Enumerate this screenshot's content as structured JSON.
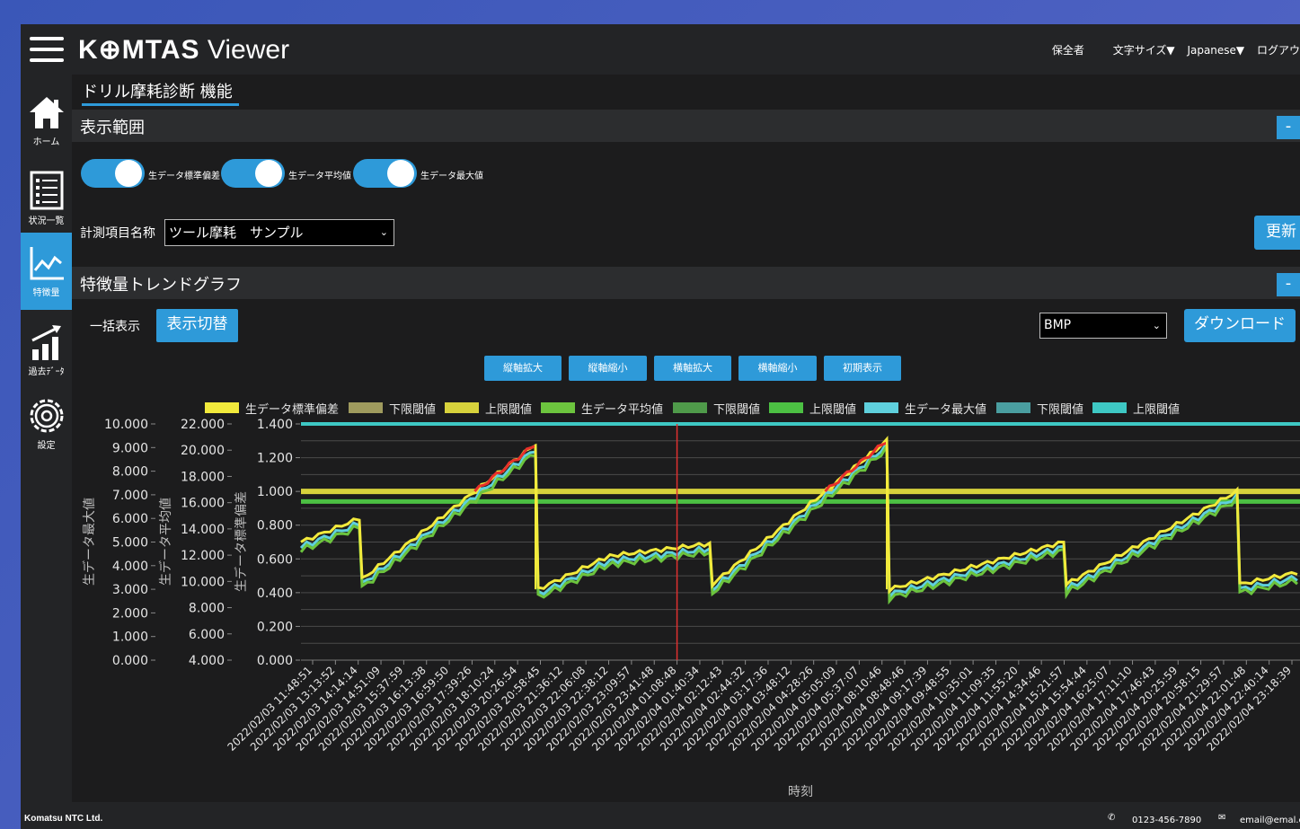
{
  "header": {
    "logo_bold": "K⊕MTAS",
    "logo_rest": " Viewer",
    "nav": [
      "保全者",
      "文字サイズ▼",
      "Japanese▼",
      "ログアウ"
    ]
  },
  "sidebar": {
    "items": [
      {
        "label": "ホーム",
        "icon": "home-icon"
      },
      {
        "label": "状況一覧",
        "icon": "list-icon"
      },
      {
        "label": "特徴量",
        "icon": "line-chart-icon"
      },
      {
        "label": "過去ﾃﾞｰﾀ",
        "icon": "bar-chart-icon"
      },
      {
        "label": "設定",
        "icon": "gear-icon"
      }
    ]
  },
  "page": {
    "title": "ドリル摩耗診断 機能",
    "section1": "表示範囲",
    "toggles": [
      "生データ標準偏差",
      "生データ平均値",
      "生データ最大値"
    ],
    "measure_label": "計測項目名称",
    "measure_value": "ツール摩耗　サンプル",
    "update_button": "更新",
    "section2": "特徴量トレンドグラフ",
    "bulk_label": "一括表示",
    "switch_button": "表示切替",
    "format_value": "BMP",
    "download_button": "ダウンロード",
    "zoom_buttons": [
      "縦軸拡大",
      "縦軸縮小",
      "横軸拡大",
      "横軸縮小",
      "初期表示"
    ],
    "minus": "-"
  },
  "chart_data": {
    "type": "line",
    "xlabel": "時刻",
    "ylabel_left1": "生データ最大値",
    "ylabel_left2": "生データ平均値",
    "ylabel_left3": "生データ標準偏差",
    "y1_ticks": [
      "10.000",
      "9.000",
      "8.000",
      "7.000",
      "6.000",
      "5.000",
      "4.000",
      "3.000",
      "2.000",
      "1.000",
      "0.000"
    ],
    "y2_ticks": [
      "22.000",
      "20.000",
      "18.000",
      "16.000",
      "14.000",
      "12.000",
      "10.000",
      "8.000",
      "6.000",
      "4.000"
    ],
    "y3_ticks": [
      "1.400",
      "1.200",
      "1.000",
      "0.800",
      "0.600",
      "0.400",
      "0.200",
      "0.000"
    ],
    "ylim_std": [
      0,
      1.4
    ],
    "x_ticks": [
      "2022/02/03 11:48:51",
      "2022/02/03 13:13:52",
      "2022/02/03 14:14:14",
      "2022/02/03 14:51:09",
      "2022/02/03 15:37:59",
      "2022/02/03 16:13:38",
      "2022/02/03 16:59:50",
      "2022/02/03 17:39:26",
      "2022/02/03 18:10:24",
      "2022/02/03 20:26:54",
      "2022/02/03 20:58:45",
      "2022/02/03 21:36:12",
      "2022/02/03 22:06:08",
      "2022/02/03 22:38:12",
      "2022/02/03 23:09:57",
      "2022/02/03 23:41:48",
      "2022/02/04 01:08:48",
      "2022/02/04 01:40:34",
      "2022/02/04 02:12:43",
      "2022/02/04 02:44:32",
      "2022/02/04 03:17:36",
      "2022/02/04 03:48:12",
      "2022/02/04 04:28:26",
      "2022/02/04 05:05:09",
      "2022/02/04 05:37:07",
      "2022/02/04 08:10:46",
      "2022/02/04 08:48:46",
      "2022/02/04 09:17:39",
      "2022/02/04 09:48:55",
      "2022/02/04 10:35:01",
      "2022/02/04 11:09:35",
      "2022/02/04 11:55:20",
      "2022/02/04 14:34:46",
      "2022/02/04 15:21:57",
      "2022/02/04 15:54:44",
      "2022/02/04 16:25:07",
      "2022/02/04 17:11:10",
      "2022/02/04 17:46:43",
      "2022/02/04 20:25:59",
      "2022/02/04 20:58:15",
      "2022/02/04 21:29:57",
      "2022/02/04 22:01:48",
      "2022/02/04 22:40:14",
      "2022/02/04 23:18:39"
    ],
    "legend": [
      {
        "name": "生データ標準偏差",
        "color": "#f2ea3c"
      },
      {
        "name": "下限閾値",
        "color": "#9f9b5e"
      },
      {
        "name": "上限閾値",
        "color": "#d7d23c"
      },
      {
        "name": "生データ平均値",
        "color": "#6cc43e"
      },
      {
        "name": "下限閾値",
        "color": "#4f9a4a"
      },
      {
        "name": "上限閾値",
        "color": "#4cc043"
      },
      {
        "name": "生データ最大値",
        "color": "#5fd0dd"
      },
      {
        "name": "下限閾値",
        "color": "#4a9ea0"
      },
      {
        "name": "上限閾値",
        "color": "#3ec8c4"
      }
    ],
    "thresholds_std": {
      "upper_yellow": 1.0,
      "upper_green": 0.94,
      "upper_cyan": 1.4
    },
    "cycles_std": [
      {
        "start": 0.7,
        "end": 0.84
      },
      {
        "start": 0.48,
        "end": 1.28,
        "over_from": 1.0
      },
      {
        "start": 0.42,
        "end": 0.62
      },
      {
        "start": 0.62,
        "end": 0.69
      },
      {
        "start": 0.45,
        "end": 1.3,
        "over_from": 1.0
      },
      {
        "start": 0.42,
        "end": 0.7
      },
      {
        "start": 0.45,
        "end": 1.0
      },
      {
        "start": 0.45,
        "end": 0.52
      }
    ],
    "cursor_x": "2022/02/04 01:08:48",
    "series_colors": {
      "std": "#f2ea3c",
      "mean": "#6cc43e",
      "max": "#5fd0dd",
      "alarm": "#e8302a",
      "cursor": "#e03030"
    }
  },
  "footer": {
    "company": "Komatsu NTC Ltd.",
    "phone": "0123-456-7890",
    "email": "email@emal.c"
  }
}
